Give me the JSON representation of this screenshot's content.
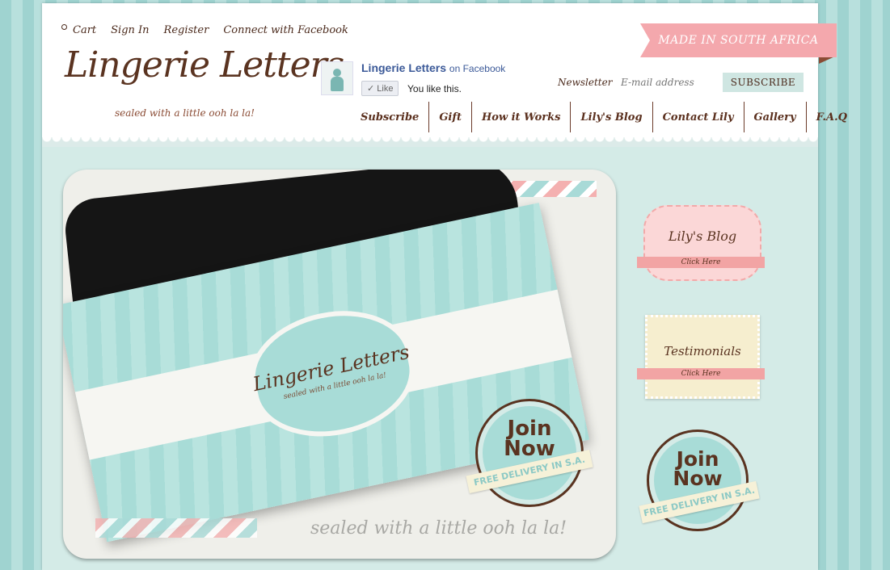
{
  "top_links": {
    "cart": "Cart",
    "sign_in": "Sign In",
    "register": "Register",
    "connect_facebook": "Connect with Facebook"
  },
  "logo": {
    "title": "Lingerie Letters",
    "tagline": "sealed with a little ooh la la!"
  },
  "facebook": {
    "page_name": "Lingerie Letters",
    "on_label": "on Facebook",
    "like_button": "✓ Like",
    "you_like": "You like this."
  },
  "banner": {
    "text": "MADE IN SOUTH AFRICA",
    "color": "#f4a8ad"
  },
  "newsletter": {
    "label": "Newsletter",
    "placeholder": "E-mail address",
    "subscribe_button": "SUBSCRIBE"
  },
  "nav": {
    "items": [
      "Subscribe",
      "Gift",
      "How it Works",
      "Lily's Blog",
      "Contact Lily",
      "Gallery",
      "F.A.Q"
    ]
  },
  "hero": {
    "envelope_title": "Lingerie Letters",
    "envelope_tagline": "sealed with a little ooh la la!",
    "tagline": "sealed with a little ooh la la!"
  },
  "badges": {
    "join_line1": "Join",
    "join_line2": "Now",
    "ribbon": "FREE DELIVERY IN S.A."
  },
  "sidebar": {
    "blog_label": "Lily's Blog",
    "testimonials_label": "Testimonials",
    "click_here": "Click Here"
  },
  "colors": {
    "brown": "#5a3320",
    "mint": "#a8dcd7",
    "pink": "#f4a8ad"
  }
}
